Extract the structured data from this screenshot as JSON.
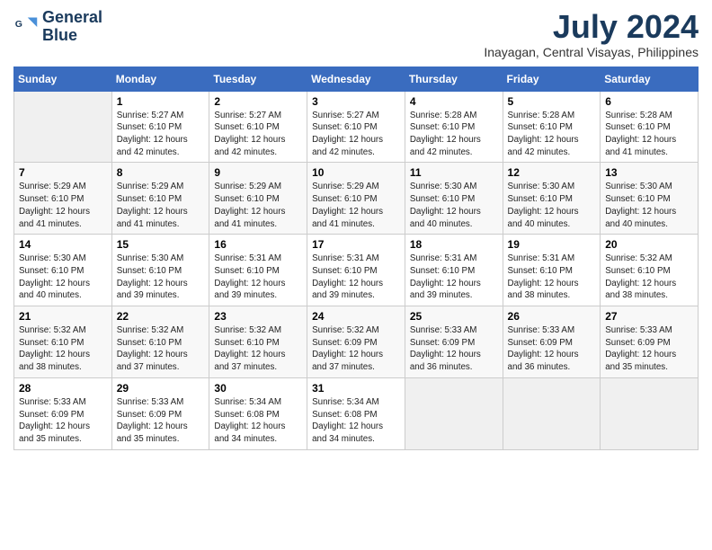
{
  "header": {
    "logo_line1": "General",
    "logo_line2": "Blue",
    "month_year": "July 2024",
    "location": "Inayagan, Central Visayas, Philippines"
  },
  "weekdays": [
    "Sunday",
    "Monday",
    "Tuesday",
    "Wednesday",
    "Thursday",
    "Friday",
    "Saturday"
  ],
  "weeks": [
    [
      {
        "day": "",
        "info": ""
      },
      {
        "day": "1",
        "info": "Sunrise: 5:27 AM\nSunset: 6:10 PM\nDaylight: 12 hours\nand 42 minutes."
      },
      {
        "day": "2",
        "info": "Sunrise: 5:27 AM\nSunset: 6:10 PM\nDaylight: 12 hours\nand 42 minutes."
      },
      {
        "day": "3",
        "info": "Sunrise: 5:27 AM\nSunset: 6:10 PM\nDaylight: 12 hours\nand 42 minutes."
      },
      {
        "day": "4",
        "info": "Sunrise: 5:28 AM\nSunset: 6:10 PM\nDaylight: 12 hours\nand 42 minutes."
      },
      {
        "day": "5",
        "info": "Sunrise: 5:28 AM\nSunset: 6:10 PM\nDaylight: 12 hours\nand 42 minutes."
      },
      {
        "day": "6",
        "info": "Sunrise: 5:28 AM\nSunset: 6:10 PM\nDaylight: 12 hours\nand 41 minutes."
      }
    ],
    [
      {
        "day": "7",
        "info": "Sunrise: 5:29 AM\nSunset: 6:10 PM\nDaylight: 12 hours\nand 41 minutes."
      },
      {
        "day": "8",
        "info": "Sunrise: 5:29 AM\nSunset: 6:10 PM\nDaylight: 12 hours\nand 41 minutes."
      },
      {
        "day": "9",
        "info": "Sunrise: 5:29 AM\nSunset: 6:10 PM\nDaylight: 12 hours\nand 41 minutes."
      },
      {
        "day": "10",
        "info": "Sunrise: 5:29 AM\nSunset: 6:10 PM\nDaylight: 12 hours\nand 41 minutes."
      },
      {
        "day": "11",
        "info": "Sunrise: 5:30 AM\nSunset: 6:10 PM\nDaylight: 12 hours\nand 40 minutes."
      },
      {
        "day": "12",
        "info": "Sunrise: 5:30 AM\nSunset: 6:10 PM\nDaylight: 12 hours\nand 40 minutes."
      },
      {
        "day": "13",
        "info": "Sunrise: 5:30 AM\nSunset: 6:10 PM\nDaylight: 12 hours\nand 40 minutes."
      }
    ],
    [
      {
        "day": "14",
        "info": "Sunrise: 5:30 AM\nSunset: 6:10 PM\nDaylight: 12 hours\nand 40 minutes."
      },
      {
        "day": "15",
        "info": "Sunrise: 5:30 AM\nSunset: 6:10 PM\nDaylight: 12 hours\nand 39 minutes."
      },
      {
        "day": "16",
        "info": "Sunrise: 5:31 AM\nSunset: 6:10 PM\nDaylight: 12 hours\nand 39 minutes."
      },
      {
        "day": "17",
        "info": "Sunrise: 5:31 AM\nSunset: 6:10 PM\nDaylight: 12 hours\nand 39 minutes."
      },
      {
        "day": "18",
        "info": "Sunrise: 5:31 AM\nSunset: 6:10 PM\nDaylight: 12 hours\nand 39 minutes."
      },
      {
        "day": "19",
        "info": "Sunrise: 5:31 AM\nSunset: 6:10 PM\nDaylight: 12 hours\nand 38 minutes."
      },
      {
        "day": "20",
        "info": "Sunrise: 5:32 AM\nSunset: 6:10 PM\nDaylight: 12 hours\nand 38 minutes."
      }
    ],
    [
      {
        "day": "21",
        "info": "Sunrise: 5:32 AM\nSunset: 6:10 PM\nDaylight: 12 hours\nand 38 minutes."
      },
      {
        "day": "22",
        "info": "Sunrise: 5:32 AM\nSunset: 6:10 PM\nDaylight: 12 hours\nand 37 minutes."
      },
      {
        "day": "23",
        "info": "Sunrise: 5:32 AM\nSunset: 6:10 PM\nDaylight: 12 hours\nand 37 minutes."
      },
      {
        "day": "24",
        "info": "Sunrise: 5:32 AM\nSunset: 6:09 PM\nDaylight: 12 hours\nand 37 minutes."
      },
      {
        "day": "25",
        "info": "Sunrise: 5:33 AM\nSunset: 6:09 PM\nDaylight: 12 hours\nand 36 minutes."
      },
      {
        "day": "26",
        "info": "Sunrise: 5:33 AM\nSunset: 6:09 PM\nDaylight: 12 hours\nand 36 minutes."
      },
      {
        "day": "27",
        "info": "Sunrise: 5:33 AM\nSunset: 6:09 PM\nDaylight: 12 hours\nand 35 minutes."
      }
    ],
    [
      {
        "day": "28",
        "info": "Sunrise: 5:33 AM\nSunset: 6:09 PM\nDaylight: 12 hours\nand 35 minutes."
      },
      {
        "day": "29",
        "info": "Sunrise: 5:33 AM\nSunset: 6:09 PM\nDaylight: 12 hours\nand 35 minutes."
      },
      {
        "day": "30",
        "info": "Sunrise: 5:34 AM\nSunset: 6:08 PM\nDaylight: 12 hours\nand 34 minutes."
      },
      {
        "day": "31",
        "info": "Sunrise: 5:34 AM\nSunset: 6:08 PM\nDaylight: 12 hours\nand 34 minutes."
      },
      {
        "day": "",
        "info": ""
      },
      {
        "day": "",
        "info": ""
      },
      {
        "day": "",
        "info": ""
      }
    ]
  ]
}
